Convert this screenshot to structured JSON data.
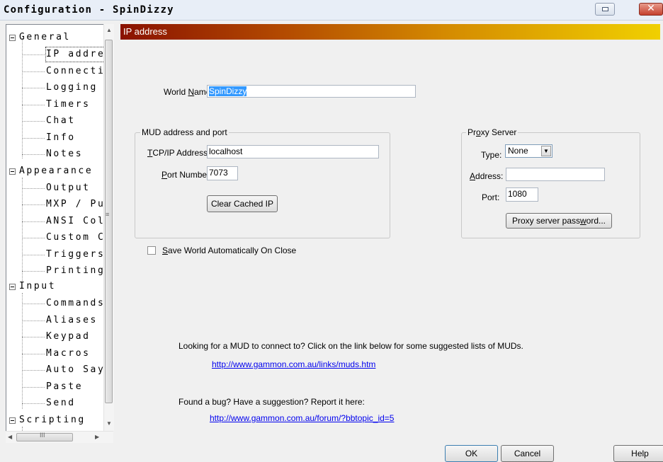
{
  "window": {
    "title": "Configuration - SpinDizzy"
  },
  "tree": [
    {
      "label": "General",
      "expanded": true,
      "children": [
        "IP address",
        "Connecting",
        "Logging",
        "Timers",
        "Chat",
        "Info",
        "Notes"
      ]
    },
    {
      "label": "Appearance",
      "expanded": true,
      "children": [
        "Output",
        "MXP / Pueblo",
        "ANSI Colour",
        "Custom Colour",
        "Triggers",
        "Printing"
      ]
    },
    {
      "label": "Input",
      "expanded": true,
      "children": [
        "Commands",
        "Aliases",
        "Keypad",
        "Macros",
        "Auto Say",
        "Paste",
        "Send"
      ]
    },
    {
      "label": "Scripting",
      "expanded": true,
      "children": []
    }
  ],
  "tree_visible": {
    "general": "General",
    "ip": "IP addres",
    "connecting": "Connectin",
    "logging": "Logging",
    "timers": "Timers",
    "chat": "Chat",
    "info": "Info",
    "notes": "Notes",
    "appearance": "Appearance",
    "output": "Output",
    "mxp": "MXP / Pue",
    "ansi": "ANSI Colo",
    "custom": "Custom Co",
    "triggers": "Triggers",
    "printing": "Printing",
    "input": "Input",
    "commands": "Commands",
    "aliases": "Aliases",
    "keypad": "Keypad",
    "macros": "Macros",
    "autosay": "Auto Say",
    "paste": "Paste",
    "send": "Send",
    "scripting": "Scripting"
  },
  "selected_page": "IP address",
  "page_header": "IP address",
  "world_name": {
    "label_pre": "World ",
    "label_hot": "N",
    "label_post": "ame:",
    "value": "SpinDizzy"
  },
  "mud_group": {
    "title": "MUD address and port",
    "tcp_label_hot": "T",
    "tcp_label_rest": "CP/IP Address:",
    "tcp_value": "localhost",
    "port_label_hot": "P",
    "port_label_rest": "ort Number:",
    "port_value": "7073",
    "clear_button": "Clear Cached IP"
  },
  "proxy_group": {
    "title_pre": "Pr",
    "title_hot": "o",
    "title_post": "xy Server",
    "type_label": "Type:",
    "type_value": "None",
    "address_label_hot": "A",
    "address_label_rest": "ddress:",
    "address_value": "",
    "port_label": "Port:",
    "port_value": "1080",
    "password_button_pre": "Proxy server pass",
    "password_button_hot": "w",
    "password_button_post": "ord..."
  },
  "save_checkbox": {
    "hot": "S",
    "rest": "ave World Automatically On Close",
    "checked": false
  },
  "info1": "Looking for a MUD to connect to? Click on the link below for some suggested lists of MUDs.",
  "link1": "http://www.gammon.com.au/links/muds.htm",
  "info2": "Found a bug? Have a suggestion? Report it here:",
  "link2": "http://www.gammon.com.au/forum/?bbtopic_id=5",
  "buttons": {
    "ok": "OK",
    "cancel": "Cancel",
    "help": "Help"
  },
  "icons": {
    "minimize": "minimize-icon",
    "close": "close-icon",
    "expander": "collapse-minus-icon"
  },
  "colors": {
    "header_start": "#8a1200",
    "header_end": "#f0d000",
    "link": "#0000ee",
    "selection": "#3399ff"
  }
}
